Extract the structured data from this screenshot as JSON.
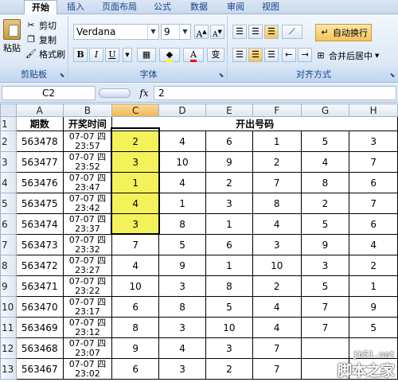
{
  "tabs": [
    "开始",
    "插入",
    "页面布局",
    "公式",
    "数据",
    "审阅",
    "视图"
  ],
  "clipboard": {
    "paste": "粘贴",
    "cut": "剪切",
    "copy": "复制",
    "format_painter": "格式刷",
    "label": "剪贴板"
  },
  "font": {
    "name": "Verdana",
    "size": "9",
    "grow": "A",
    "shrink": "A",
    "bold": "B",
    "italic": "I",
    "underline": "U",
    "color_letter": "A",
    "phonetic": "变",
    "label": "字体"
  },
  "alignment": {
    "wrap_text": "自动换行",
    "merge_center": "合并后居中",
    "label": "对齐方式"
  },
  "formula_bar": {
    "name_box": "C2",
    "fx": "fx",
    "content": "2"
  },
  "columns": [
    "A",
    "B",
    "C",
    "D",
    "E",
    "F",
    "G",
    "H"
  ],
  "header_row": {
    "a": "期数",
    "b": "开奖时间",
    "merged": "开出号码"
  },
  "rows": [
    {
      "n": "1"
    },
    {
      "n": "2",
      "a": "563478",
      "date": "07-07 四",
      "time": "23:57",
      "c": "2",
      "d": "4",
      "e": "6",
      "f": "1",
      "g": "5",
      "h": "3"
    },
    {
      "n": "3",
      "a": "563477",
      "date": "07-07 四",
      "time": "23:52",
      "c": "3",
      "d": "10",
      "e": "9",
      "f": "2",
      "g": "4",
      "h": "7"
    },
    {
      "n": "4",
      "a": "563476",
      "date": "07-07 四",
      "time": "23:47",
      "c": "1",
      "d": "4",
      "e": "2",
      "f": "7",
      "g": "8",
      "h": "6"
    },
    {
      "n": "5",
      "a": "563475",
      "date": "07-07 四",
      "time": "23:42",
      "c": "4",
      "d": "1",
      "e": "3",
      "f": "8",
      "g": "2",
      "h": "7"
    },
    {
      "n": "6",
      "a": "563474",
      "date": "07-07 四",
      "time": "23:37",
      "c": "3",
      "d": "8",
      "e": "1",
      "f": "4",
      "g": "5",
      "h": "6"
    },
    {
      "n": "7",
      "a": "563473",
      "date": "07-07 四",
      "time": "23:32",
      "c": "7",
      "d": "5",
      "e": "6",
      "f": "3",
      "g": "9",
      "h": "4"
    },
    {
      "n": "8",
      "a": "563472",
      "date": "07-07 四",
      "time": "23:27",
      "c": "4",
      "d": "9",
      "e": "1",
      "f": "10",
      "g": "3",
      "h": "2"
    },
    {
      "n": "9",
      "a": "563471",
      "date": "07-07 四",
      "time": "23:22",
      "c": "10",
      "d": "3",
      "e": "8",
      "f": "2",
      "g": "5",
      "h": "1"
    },
    {
      "n": "10",
      "a": "563470",
      "date": "07-07 四",
      "time": "23:17",
      "c": "6",
      "d": "8",
      "e": "5",
      "f": "4",
      "g": "7",
      "h": "9"
    },
    {
      "n": "11",
      "a": "563469",
      "date": "07-07 四",
      "time": "23:12",
      "c": "8",
      "d": "3",
      "e": "10",
      "f": "4",
      "g": "7",
      "h": "5"
    },
    {
      "n": "12",
      "a": "563468",
      "date": "07-07 四",
      "time": "23:07",
      "c": "9",
      "d": "4",
      "e": "3",
      "f": "7",
      "g": "",
      "h": ""
    },
    {
      "n": "13",
      "a": "563467",
      "date": "07-07 四",
      "time": "23:02",
      "c": "6",
      "d": "3",
      "e": "2",
      "f": "7",
      "g": "",
      "h": ""
    }
  ],
  "watermark": {
    "site": "jb51.net",
    "name": "脚本之家"
  },
  "colors": {
    "highlight": "#f3f25b",
    "selected_header": "#f1b852"
  }
}
